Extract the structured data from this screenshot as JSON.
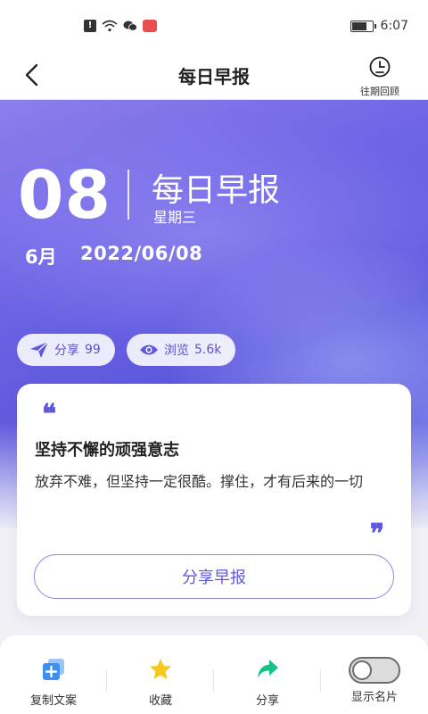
{
  "status_bar": {
    "time": "6:07",
    "alert_symbol": "!",
    "icons": [
      "alert-icon",
      "wifi-icon",
      "wechat-icon",
      "app-notification-icon",
      "battery-icon"
    ]
  },
  "nav": {
    "title": "每日早报",
    "history_label": "往期回顾",
    "back_icon": "chevron-left-icon",
    "history_icon": "clock-history-icon"
  },
  "hero": {
    "day": "08",
    "title": "每日早报",
    "weekday": "星期三",
    "month": "6月",
    "date": "2022/06/08",
    "share_label": "分享",
    "share_count": "99",
    "view_label": "浏览",
    "view_count": "5.6k",
    "colors": {
      "gradient_start": "#8c7fea",
      "gradient_mid": "#5d58dd",
      "gradient_end": "#6e78e8"
    }
  },
  "card": {
    "open_quote": "❝",
    "close_quote": "❞",
    "title": "坚持不懈的顽强意志",
    "text": "放弃不难，但坚持一定很酷。撑住，才有后来的一切",
    "button_label": "分享早报"
  },
  "bottom_bar": {
    "items": [
      {
        "label": "复制文案",
        "icon": "copy-add-icon",
        "color": "#3d8ef5"
      },
      {
        "label": "收藏",
        "icon": "star-icon",
        "color": "#f7c81e"
      },
      {
        "label": "分享",
        "icon": "share-arrow-icon",
        "color": "#17c28a"
      },
      {
        "label": "显示名片",
        "icon": "toggle-icon",
        "state": "off"
      }
    ]
  },
  "accent_color": "#5d58dd"
}
